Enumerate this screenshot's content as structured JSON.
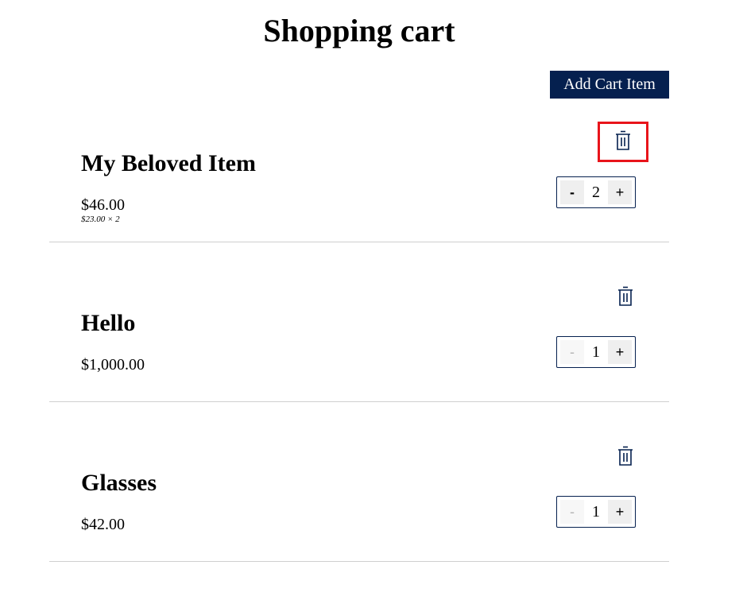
{
  "page": {
    "title": "Shopping cart",
    "add_button_label": "Add Cart Item"
  },
  "colors": {
    "primary": "#05204f",
    "highlight": "#e8141b",
    "divider": "#cfcfcf"
  },
  "cart": {
    "items": [
      {
        "name": "My Beloved Item",
        "total": "$46.00",
        "breakdown": "$23.00 × 2",
        "quantity": "2",
        "minus_label": "-",
        "plus_label": "+",
        "delete_icon": "trash-icon",
        "minus_enabled": true,
        "delete_highlighted": true
      },
      {
        "name": "Hello",
        "total": "$1,000.00",
        "breakdown": "",
        "quantity": "1",
        "minus_label": "-",
        "plus_label": "+",
        "delete_icon": "trash-icon",
        "minus_enabled": false,
        "delete_highlighted": false
      },
      {
        "name": "Glasses",
        "total": "$42.00",
        "breakdown": "",
        "quantity": "1",
        "minus_label": "-",
        "plus_label": "+",
        "delete_icon": "trash-icon",
        "minus_enabled": false,
        "delete_highlighted": false
      }
    ]
  }
}
